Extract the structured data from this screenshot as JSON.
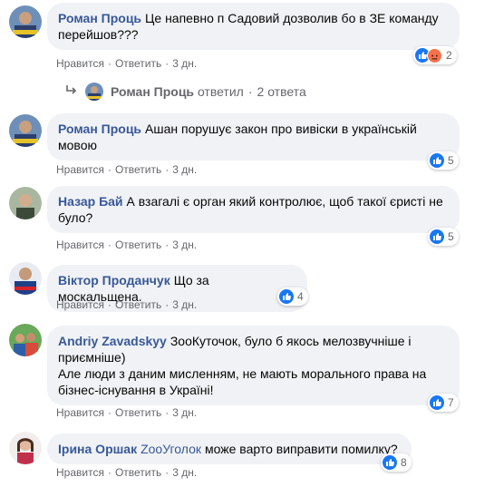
{
  "actions": {
    "like": "Нравится",
    "reply": "Ответить",
    "separator": "·"
  },
  "comments": [
    {
      "author": "Роман Проць",
      "text": "Це напевно п Садовий дозволив бо в ЗЕ команду перейшов???",
      "time": "3 дн.",
      "reactions": "2",
      "reaction_icons": [
        "like-icon",
        "angry-icon"
      ]
    },
    {
      "author": "Роман Проць",
      "text": "Ашан порушує закон про вивіски в українській мовою",
      "time": "3 дн.",
      "reactions": "5",
      "reaction_icons": [
        "like-icon"
      ]
    },
    {
      "author": "Назар Бай",
      "text": "А взагалі є орган який контролює, щоб такої єристі не було?",
      "time": "3 дн.",
      "reactions": "5",
      "reaction_icons": [
        "like-icon"
      ]
    },
    {
      "author": "Віктор Проданчук",
      "text": "Що за москальщена.",
      "time": "3 дн.",
      "reactions": "4",
      "reaction_icons": [
        "like-icon"
      ]
    },
    {
      "author": "Andriy Zavadskyy",
      "text": "ЗооКуточок, було б якось мелозвучніше і приємніше)",
      "text2": "Але люди з даним мисленням, не мають морального права на бізнес-існування в Україні!",
      "time": "3 дн.",
      "reactions": "7",
      "reaction_icons": [
        "like-icon"
      ]
    },
    {
      "author": "Ірина Оршак",
      "tag": "ZooУголок",
      "text": "може варто виправити помилку?",
      "time": "3 дн.",
      "reactions": "8",
      "reaction_icons": [
        "like-icon"
      ]
    }
  ],
  "reply_thread": {
    "author": "Роман Проць",
    "action": "ответил",
    "count": "2 ответа"
  },
  "colors": {
    "link": "#385898",
    "bubble": "#f0f2f5",
    "meta": "#65676b",
    "like": "#1877f2",
    "angry": "#f7714c"
  }
}
